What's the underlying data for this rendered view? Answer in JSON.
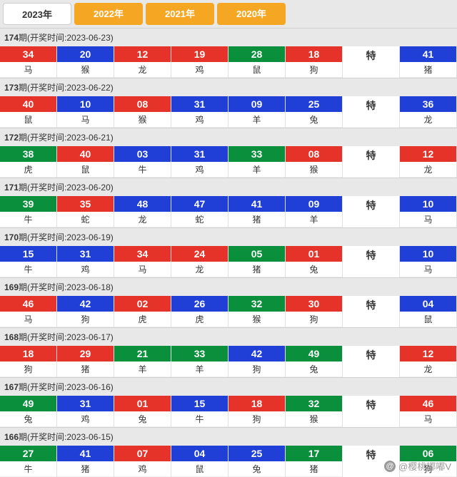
{
  "tabs": [
    {
      "label": "2023年",
      "active": true
    },
    {
      "label": "2022年",
      "active": false
    },
    {
      "label": "2021年",
      "active": false
    },
    {
      "label": "2020年",
      "active": false
    }
  ],
  "header_prefix": "期(开奖时间:",
  "header_suffix": ")",
  "special_label": "特",
  "periods": [
    {
      "issue": "174",
      "date": "2023-06-23",
      "balls": [
        {
          "num": "34",
          "zodiac": "马",
          "color": "red"
        },
        {
          "num": "20",
          "zodiac": "猴",
          "color": "blue"
        },
        {
          "num": "12",
          "zodiac": "龙",
          "color": "red"
        },
        {
          "num": "19",
          "zodiac": "鸡",
          "color": "red"
        },
        {
          "num": "28",
          "zodiac": "鼠",
          "color": "green"
        },
        {
          "num": "18",
          "zodiac": "狗",
          "color": "red"
        }
      ],
      "special": {
        "num": "41",
        "zodiac": "猪",
        "color": "blue"
      }
    },
    {
      "issue": "173",
      "date": "2023-06-22",
      "balls": [
        {
          "num": "40",
          "zodiac": "鼠",
          "color": "red"
        },
        {
          "num": "10",
          "zodiac": "马",
          "color": "blue"
        },
        {
          "num": "08",
          "zodiac": "猴",
          "color": "red"
        },
        {
          "num": "31",
          "zodiac": "鸡",
          "color": "blue"
        },
        {
          "num": "09",
          "zodiac": "羊",
          "color": "blue"
        },
        {
          "num": "25",
          "zodiac": "兔",
          "color": "blue"
        }
      ],
      "special": {
        "num": "36",
        "zodiac": "龙",
        "color": "blue"
      }
    },
    {
      "issue": "172",
      "date": "2023-06-21",
      "balls": [
        {
          "num": "38",
          "zodiac": "虎",
          "color": "green"
        },
        {
          "num": "40",
          "zodiac": "鼠",
          "color": "red"
        },
        {
          "num": "03",
          "zodiac": "牛",
          "color": "blue"
        },
        {
          "num": "31",
          "zodiac": "鸡",
          "color": "blue"
        },
        {
          "num": "33",
          "zodiac": "羊",
          "color": "green"
        },
        {
          "num": "08",
          "zodiac": "猴",
          "color": "red"
        }
      ],
      "special": {
        "num": "12",
        "zodiac": "龙",
        "color": "red"
      }
    },
    {
      "issue": "171",
      "date": "2023-06-20",
      "balls": [
        {
          "num": "39",
          "zodiac": "牛",
          "color": "green"
        },
        {
          "num": "35",
          "zodiac": "蛇",
          "color": "red"
        },
        {
          "num": "48",
          "zodiac": "龙",
          "color": "blue"
        },
        {
          "num": "47",
          "zodiac": "蛇",
          "color": "blue"
        },
        {
          "num": "41",
          "zodiac": "猪",
          "color": "blue"
        },
        {
          "num": "09",
          "zodiac": "羊",
          "color": "blue"
        }
      ],
      "special": {
        "num": "10",
        "zodiac": "马",
        "color": "blue"
      }
    },
    {
      "issue": "170",
      "date": "2023-06-19",
      "balls": [
        {
          "num": "15",
          "zodiac": "牛",
          "color": "blue"
        },
        {
          "num": "31",
          "zodiac": "鸡",
          "color": "blue"
        },
        {
          "num": "34",
          "zodiac": "马",
          "color": "red"
        },
        {
          "num": "24",
          "zodiac": "龙",
          "color": "red"
        },
        {
          "num": "05",
          "zodiac": "猪",
          "color": "green"
        },
        {
          "num": "01",
          "zodiac": "兔",
          "color": "red"
        }
      ],
      "special": {
        "num": "10",
        "zodiac": "马",
        "color": "blue"
      }
    },
    {
      "issue": "169",
      "date": "2023-06-18",
      "balls": [
        {
          "num": "46",
          "zodiac": "马",
          "color": "red"
        },
        {
          "num": "42",
          "zodiac": "狗",
          "color": "blue"
        },
        {
          "num": "02",
          "zodiac": "虎",
          "color": "red"
        },
        {
          "num": "26",
          "zodiac": "虎",
          "color": "blue"
        },
        {
          "num": "32",
          "zodiac": "猴",
          "color": "green"
        },
        {
          "num": "30",
          "zodiac": "狗",
          "color": "red"
        }
      ],
      "special": {
        "num": "04",
        "zodiac": "鼠",
        "color": "blue"
      }
    },
    {
      "issue": "168",
      "date": "2023-06-17",
      "balls": [
        {
          "num": "18",
          "zodiac": "狗",
          "color": "red"
        },
        {
          "num": "29",
          "zodiac": "猪",
          "color": "red"
        },
        {
          "num": "21",
          "zodiac": "羊",
          "color": "green"
        },
        {
          "num": "33",
          "zodiac": "羊",
          "color": "green"
        },
        {
          "num": "42",
          "zodiac": "狗",
          "color": "blue"
        },
        {
          "num": "49",
          "zodiac": "兔",
          "color": "green"
        }
      ],
      "special": {
        "num": "12",
        "zodiac": "龙",
        "color": "red"
      }
    },
    {
      "issue": "167",
      "date": "2023-06-16",
      "balls": [
        {
          "num": "49",
          "zodiac": "兔",
          "color": "green"
        },
        {
          "num": "31",
          "zodiac": "鸡",
          "color": "blue"
        },
        {
          "num": "01",
          "zodiac": "兔",
          "color": "red"
        },
        {
          "num": "15",
          "zodiac": "牛",
          "color": "blue"
        },
        {
          "num": "18",
          "zodiac": "狗",
          "color": "red"
        },
        {
          "num": "32",
          "zodiac": "猴",
          "color": "green"
        }
      ],
      "special": {
        "num": "46",
        "zodiac": "马",
        "color": "red"
      }
    },
    {
      "issue": "166",
      "date": "2023-06-15",
      "balls": [
        {
          "num": "27",
          "zodiac": "牛",
          "color": "green"
        },
        {
          "num": "41",
          "zodiac": "猪",
          "color": "blue"
        },
        {
          "num": "07",
          "zodiac": "鸡",
          "color": "red"
        },
        {
          "num": "04",
          "zodiac": "鼠",
          "color": "blue"
        },
        {
          "num": "25",
          "zodiac": "兔",
          "color": "blue"
        },
        {
          "num": "17",
          "zodiac": "猪",
          "color": "green"
        }
      ],
      "special": {
        "num": "06",
        "zodiac": "狗",
        "color": "green"
      }
    }
  ],
  "watermark": "@樱桃嘟嘟V"
}
